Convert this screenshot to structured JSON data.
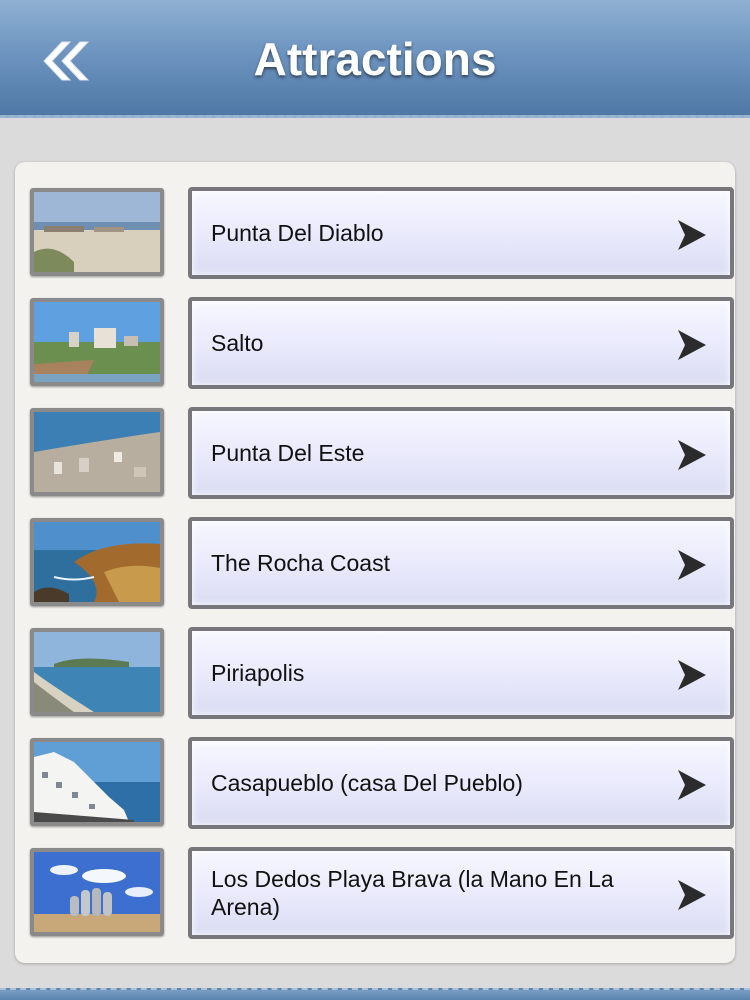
{
  "header": {
    "title": "Attractions",
    "back_icon": "double-chevron-left-icon"
  },
  "attractions": [
    {
      "label": "Punta Del Diablo",
      "thumb": "beach-town-photo"
    },
    {
      "label": "Salto",
      "thumb": "riverside-town-photo"
    },
    {
      "label": "Punta Del Este",
      "thumb": "coastal-city-aerial-photo"
    },
    {
      "label": "The Rocha Coast",
      "thumb": "rocky-coast-photo"
    },
    {
      "label": "Piriapolis",
      "thumb": "bay-shoreline-photo"
    },
    {
      "label": "Casapueblo (casa Del Pueblo)",
      "thumb": "white-cliff-building-photo"
    },
    {
      "label": "Los Dedos Playa Brava (la Mano En La Arena)",
      "thumb": "hand-sculpture-beach-photo"
    }
  ],
  "colors": {
    "header_top": "#8fb0d2",
    "header_bottom": "#4f78a6",
    "row_border": "#77777b",
    "row_fill": "#e8e9fb"
  }
}
